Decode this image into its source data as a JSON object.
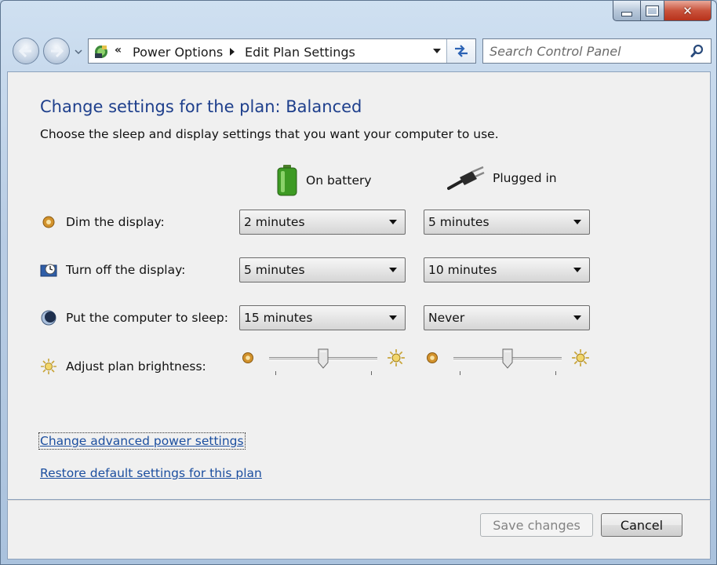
{
  "window": {
    "caption_buttons": {
      "minimize_icon": "minimize-icon",
      "maximize_icon": "maximize-icon",
      "close_icon": "close-icon"
    }
  },
  "nav": {
    "back_icon": "back-arrow-icon",
    "forward_icon": "forward-arrow-icon",
    "address": {
      "overflow": "«",
      "crumbs": [
        "Power Options",
        "Edit Plan Settings"
      ]
    },
    "search_placeholder": "Search Control Panel"
  },
  "page": {
    "title": "Change settings for the plan: Balanced",
    "subtitle": "Choose the sleep and display settings that you want your computer to use.",
    "columns": {
      "on_battery": "On battery",
      "plugged_in": "Plugged in"
    },
    "rows": [
      {
        "label": "Dim the display:",
        "icon": "dim-display-icon",
        "battery": "2 minutes",
        "plugged": "5 minutes"
      },
      {
        "label": "Turn off the display:",
        "icon": "display-off-icon",
        "battery": "5 minutes",
        "plugged": "10 minutes"
      },
      {
        "label": "Put the computer to sleep:",
        "icon": "sleep-moon-icon",
        "battery": "15 minutes",
        "plugged": "Never"
      }
    ],
    "brightness": {
      "label": "Adjust plan brightness:",
      "battery_level": 0.5,
      "plugged_level": 0.5
    },
    "links": {
      "advanced": "Change advanced power settings",
      "restore": "Restore default settings for this plan"
    }
  },
  "footer": {
    "save": "Save changes",
    "cancel": "Cancel"
  },
  "colors": {
    "title_blue": "#1e3f8c",
    "link_blue": "#1b4e9f"
  }
}
